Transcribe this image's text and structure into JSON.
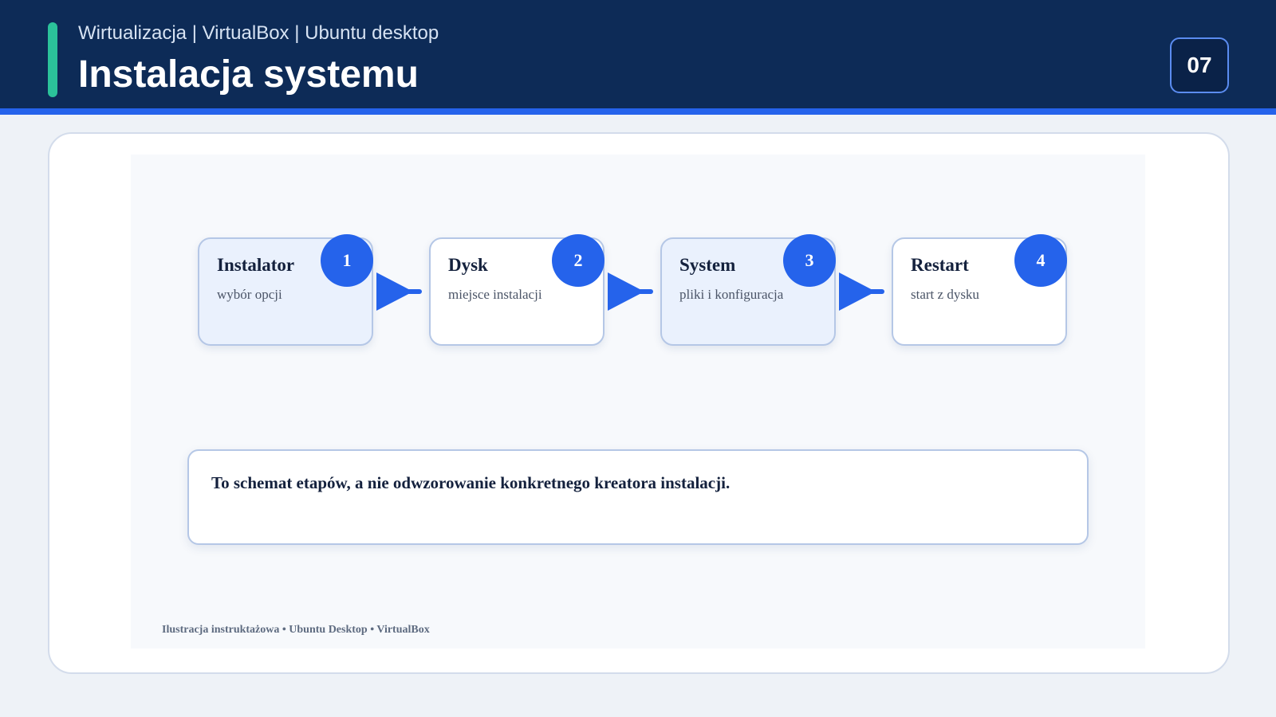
{
  "header": {
    "subtitle": "Wirtualizacja | VirtualBox | Ubuntu desktop",
    "title": "Instalacja systemu",
    "page_number": "07"
  },
  "steps": [
    {
      "number": "1",
      "title": "Instalator",
      "description": "wybór opcji"
    },
    {
      "number": "2",
      "title": "Dysk",
      "description": "miejsce instalacji"
    },
    {
      "number": "3",
      "title": "System",
      "description": "pliki i konfiguracja"
    },
    {
      "number": "4",
      "title": "Restart",
      "description": "start z dysku"
    }
  ],
  "note": "To schemat etapów, a nie odwzorowanie konkretnego kreatora instalacji.",
  "footer": "Ilustracja instruktażowa • Ubuntu Desktop • VirtualBox",
  "colors": {
    "header_bg": "#0d2b57",
    "accent": "#2bc29a",
    "primary": "#2563eb"
  }
}
